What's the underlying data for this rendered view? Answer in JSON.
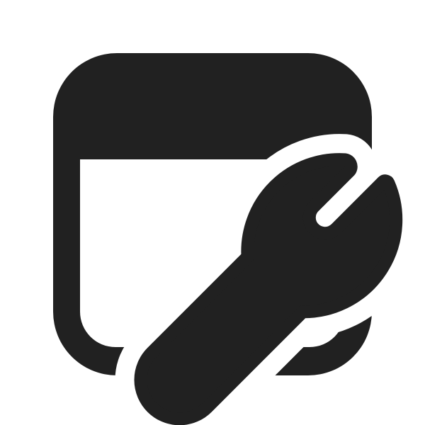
{
  "icon": {
    "name": "window-wrench-icon",
    "color": "#212121",
    "background": "#ffffff"
  }
}
